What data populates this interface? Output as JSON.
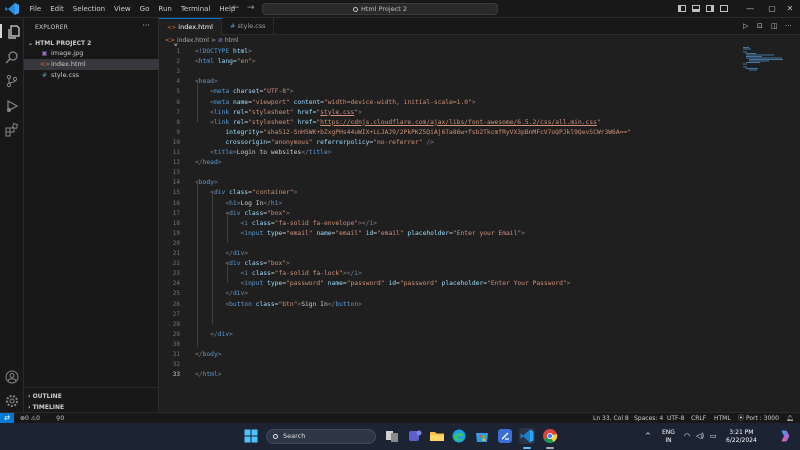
{
  "menu": [
    "File",
    "Edit",
    "Selection",
    "View",
    "Go",
    "Run",
    "Terminal",
    "Help"
  ],
  "search": {
    "label": "Html Project 2"
  },
  "sidebar": {
    "header": "EXPLORER",
    "more": "···",
    "folder": "HTML PROJECT 2",
    "files": [
      {
        "name": "image.jpg",
        "icon": "image-file-icon",
        "glyph": "▣",
        "color": "#a074c4"
      },
      {
        "name": "index.html",
        "icon": "html-file-icon",
        "glyph": "<>",
        "color": "#e37933"
      },
      {
        "name": "style.css",
        "icon": "css-file-icon",
        "glyph": "#",
        "color": "#519aba"
      }
    ],
    "outline": "OUTLINE",
    "timeline": "TIMELINE"
  },
  "tabs": [
    {
      "label": "index.html",
      "glyph": "<>",
      "color": "#e37933",
      "close": "×"
    },
    {
      "label": "style.css",
      "glyph": "#",
      "color": "#519aba"
    }
  ],
  "breadcrumb": {
    "file": "index.html",
    "sep": ">",
    "node": "html"
  },
  "editor": {
    "current_line": 33,
    "lines": [
      [
        [
          "br",
          "<"
        ],
        [
          "tag",
          "!DOCTYPE"
        ],
        [
          "txt",
          " "
        ],
        [
          "attr",
          "html"
        ],
        [
          "br",
          ">"
        ]
      ],
      [
        [
          "br",
          "<"
        ],
        [
          "tag",
          "html"
        ],
        [
          "txt",
          " "
        ],
        [
          "attr",
          "lang"
        ],
        [
          "txt",
          "="
        ],
        [
          "str",
          "\"en\""
        ],
        [
          "br",
          ">"
        ]
      ],
      [],
      [
        [
          "br",
          "<"
        ],
        [
          "tag",
          "head"
        ],
        [
          "br",
          ">"
        ]
      ],
      [
        [
          "txt",
          "    "
        ],
        [
          "br",
          "<"
        ],
        [
          "tag",
          "meta"
        ],
        [
          "txt",
          " "
        ],
        [
          "attr",
          "charset"
        ],
        [
          "txt",
          "="
        ],
        [
          "str",
          "\"UTF-8\""
        ],
        [
          "br",
          ">"
        ]
      ],
      [
        [
          "txt",
          "    "
        ],
        [
          "br",
          "<"
        ],
        [
          "tag",
          "meta"
        ],
        [
          "txt",
          " "
        ],
        [
          "attr",
          "name"
        ],
        [
          "txt",
          "="
        ],
        [
          "str",
          "\"viewport\""
        ],
        [
          "txt",
          " "
        ],
        [
          "attr",
          "content"
        ],
        [
          "txt",
          "="
        ],
        [
          "str",
          "\"width=device-width, initial-scale=1.0\""
        ],
        [
          "br",
          ">"
        ]
      ],
      [
        [
          "txt",
          "    "
        ],
        [
          "br",
          "<"
        ],
        [
          "tag",
          "link"
        ],
        [
          "txt",
          " "
        ],
        [
          "attr",
          "rel"
        ],
        [
          "txt",
          "="
        ],
        [
          "str",
          "\"stylesheet\""
        ],
        [
          "txt",
          " "
        ],
        [
          "attr",
          "href"
        ],
        [
          "txt",
          "="
        ],
        [
          "str",
          "\""
        ],
        [
          "link",
          "style.css"
        ],
        [
          "str",
          "\""
        ],
        [
          "br",
          ">"
        ]
      ],
      [
        [
          "txt",
          "    "
        ],
        [
          "br",
          "<"
        ],
        [
          "tag",
          "link"
        ],
        [
          "txt",
          " "
        ],
        [
          "attr",
          "rel"
        ],
        [
          "txt",
          "="
        ],
        [
          "str",
          "\"stylesheet\""
        ],
        [
          "txt",
          " "
        ],
        [
          "attr",
          "href"
        ],
        [
          "txt",
          "="
        ],
        [
          "str",
          "\""
        ],
        [
          "link",
          "https://cdnjs.cloudflare.com/ajax/libs/font-awesome/6.5.2/css/all.min.css"
        ],
        [
          "str",
          "\""
        ]
      ],
      [
        [
          "txt",
          "        "
        ],
        [
          "attr",
          "integrity"
        ],
        [
          "txt",
          "="
        ],
        [
          "str",
          "\"sha512-SnH5WK+bZxgPHs44uWIX+LLJAJ9/2PkPKZ5QiAj6Ta86w+fsb2TkcmfRyVX3pBnMFcV7oQPJkl9QevSCWr3W6A==\""
        ]
      ],
      [
        [
          "txt",
          "        "
        ],
        [
          "attr",
          "crossorigin"
        ],
        [
          "txt",
          "="
        ],
        [
          "str",
          "\"anonymous\""
        ],
        [
          "txt",
          " "
        ],
        [
          "attr",
          "referrerpolicy"
        ],
        [
          "txt",
          "="
        ],
        [
          "str",
          "\"no-referrer\""
        ],
        [
          "txt",
          " "
        ],
        [
          "br",
          "/>"
        ]
      ],
      [
        [
          "txt",
          "    "
        ],
        [
          "br",
          "<"
        ],
        [
          "tag",
          "title"
        ],
        [
          "br",
          ">"
        ],
        [
          "txt",
          "Login to websites"
        ],
        [
          "br",
          "</"
        ],
        [
          "tag",
          "title"
        ],
        [
          "br",
          ">"
        ]
      ],
      [
        [
          "br",
          "</"
        ],
        [
          "tag",
          "head"
        ],
        [
          "br",
          ">"
        ]
      ],
      [],
      [
        [
          "br",
          "<"
        ],
        [
          "tag",
          "body"
        ],
        [
          "br",
          ">"
        ]
      ],
      [
        [
          "txt",
          "    "
        ],
        [
          "br",
          "<"
        ],
        [
          "tag",
          "div"
        ],
        [
          "txt",
          " "
        ],
        [
          "attr",
          "class"
        ],
        [
          "txt",
          "="
        ],
        [
          "str",
          "\"container\""
        ],
        [
          "br",
          ">"
        ]
      ],
      [
        [
          "txt",
          "        "
        ],
        [
          "br",
          "<"
        ],
        [
          "tag",
          "h1"
        ],
        [
          "br",
          ">"
        ],
        [
          "txt",
          "Log In"
        ],
        [
          "br",
          "</"
        ],
        [
          "tag",
          "h1"
        ],
        [
          "br",
          ">"
        ]
      ],
      [
        [
          "txt",
          "        "
        ],
        [
          "br",
          "<"
        ],
        [
          "tag",
          "div"
        ],
        [
          "txt",
          " "
        ],
        [
          "attr",
          "class"
        ],
        [
          "txt",
          "="
        ],
        [
          "str",
          "\"box\""
        ],
        [
          "br",
          ">"
        ]
      ],
      [
        [
          "txt",
          "            "
        ],
        [
          "br",
          "<"
        ],
        [
          "tag",
          "i"
        ],
        [
          "txt",
          " "
        ],
        [
          "attr",
          "class"
        ],
        [
          "txt",
          "="
        ],
        [
          "str",
          "\"fa-solid fa-envelope\""
        ],
        [
          "br",
          "></"
        ],
        [
          "tag",
          "i"
        ],
        [
          "br",
          ">"
        ]
      ],
      [
        [
          "txt",
          "            "
        ],
        [
          "br",
          "<"
        ],
        [
          "tag",
          "input"
        ],
        [
          "txt",
          " "
        ],
        [
          "attr",
          "type"
        ],
        [
          "txt",
          "="
        ],
        [
          "str",
          "\"email\""
        ],
        [
          "txt",
          " "
        ],
        [
          "attr",
          "name"
        ],
        [
          "txt",
          "="
        ],
        [
          "str",
          "\"email\""
        ],
        [
          "txt",
          " "
        ],
        [
          "attr",
          "id"
        ],
        [
          "txt",
          "="
        ],
        [
          "str",
          "\"email\""
        ],
        [
          "txt",
          " "
        ],
        [
          "attr",
          "placeholder"
        ],
        [
          "txt",
          "="
        ],
        [
          "str",
          "\"Enter your Email\""
        ],
        [
          "br",
          ">"
        ]
      ],
      [],
      [
        [
          "txt",
          "        "
        ],
        [
          "br",
          "</"
        ],
        [
          "tag",
          "div"
        ],
        [
          "br",
          ">"
        ]
      ],
      [
        [
          "txt",
          "        "
        ],
        [
          "br",
          "<"
        ],
        [
          "tag",
          "div"
        ],
        [
          "txt",
          " "
        ],
        [
          "attr",
          "class"
        ],
        [
          "txt",
          "="
        ],
        [
          "str",
          "\"box\""
        ],
        [
          "br",
          ">"
        ]
      ],
      [
        [
          "txt",
          "            "
        ],
        [
          "br",
          "<"
        ],
        [
          "tag",
          "i"
        ],
        [
          "txt",
          " "
        ],
        [
          "attr",
          "class"
        ],
        [
          "txt",
          "="
        ],
        [
          "str",
          "\"fa-solid fa-lock\""
        ],
        [
          "br",
          "></"
        ],
        [
          "tag",
          "i"
        ],
        [
          "br",
          ">"
        ]
      ],
      [
        [
          "txt",
          "            "
        ],
        [
          "br",
          "<"
        ],
        [
          "tag",
          "input"
        ],
        [
          "txt",
          " "
        ],
        [
          "attr",
          "type"
        ],
        [
          "txt",
          "="
        ],
        [
          "str",
          "\"password\""
        ],
        [
          "txt",
          " "
        ],
        [
          "attr",
          "name"
        ],
        [
          "txt",
          "="
        ],
        [
          "str",
          "\"password\""
        ],
        [
          "txt",
          " "
        ],
        [
          "attr",
          "id"
        ],
        [
          "txt",
          "="
        ],
        [
          "str",
          "\"password\""
        ],
        [
          "txt",
          " "
        ],
        [
          "attr",
          "placeholder"
        ],
        [
          "txt",
          "="
        ],
        [
          "str",
          "\"Enter Your Password\""
        ],
        [
          "br",
          ">"
        ]
      ],
      [
        [
          "txt",
          "        "
        ],
        [
          "br",
          "</"
        ],
        [
          "tag",
          "div"
        ],
        [
          "br",
          ">"
        ]
      ],
      [
        [
          "txt",
          "        "
        ],
        [
          "br",
          "<"
        ],
        [
          "tag",
          "button"
        ],
        [
          "txt",
          " "
        ],
        [
          "attr",
          "class"
        ],
        [
          "txt",
          "="
        ],
        [
          "str",
          "\"btn\""
        ],
        [
          "br",
          ">"
        ],
        [
          "txt",
          "Sign In"
        ],
        [
          "br",
          "</"
        ],
        [
          "tag",
          "button"
        ],
        [
          "br",
          ">"
        ]
      ],
      [],
      [],
      [
        [
          "txt",
          "    "
        ],
        [
          "br",
          "</"
        ],
        [
          "tag",
          "div"
        ],
        [
          "br",
          ">"
        ]
      ],
      [],
      [
        [
          "br",
          "</"
        ],
        [
          "tag",
          "body"
        ],
        [
          "br",
          ">"
        ]
      ],
      [],
      [
        [
          "br",
          "</"
        ],
        [
          "tag",
          "html"
        ],
        [
          "br",
          ">"
        ]
      ]
    ]
  },
  "statusbar": {
    "remote": "⇄",
    "errors": "0",
    "warnings": "0",
    "ports": "0",
    "position": "Ln 33, Col 8",
    "spaces": "Spaces: 4",
    "encoding": "UTF-8",
    "eol": "CRLF",
    "language": "HTML",
    "port": "Port : 3000"
  },
  "taskbar": {
    "search": "Search",
    "lang_top": "ENG",
    "lang_bottom": "IN",
    "time": "3:21 PM",
    "date": "6/22/2024"
  },
  "colors": {
    "accent": "#0078d4",
    "tag": "#569cd6",
    "attr": "#9cdcfe",
    "string": "#ce9178"
  }
}
